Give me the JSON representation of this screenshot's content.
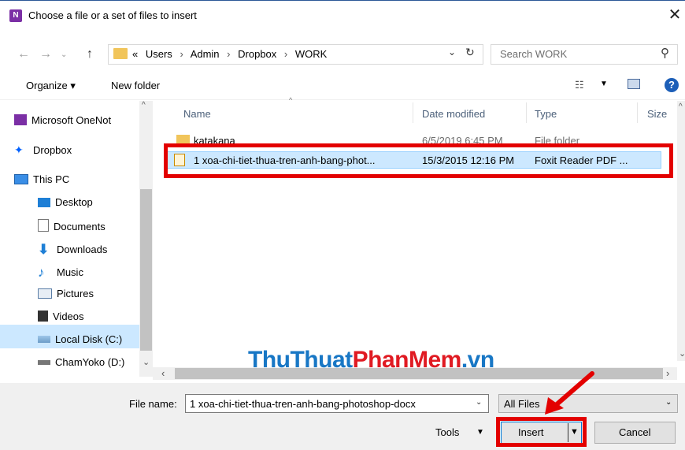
{
  "window": {
    "title": "Choose a file or a set of files to insert",
    "app_icon": "onenote-icon",
    "close": "✕"
  },
  "address": {
    "crumbs": [
      "«",
      "Users",
      "Admin",
      "Dropbox",
      "WORK"
    ],
    "separator": "›",
    "search_placeholder": "Search WORK"
  },
  "toolbar": {
    "organize": "Organize ▾",
    "new_folder": "New folder"
  },
  "nav": {
    "items": [
      {
        "label": "Microsoft OneNot",
        "icon": "onenote-icon"
      },
      {
        "label": "Dropbox",
        "icon": "dropbox-icon"
      },
      {
        "label": "This PC",
        "icon": "pc-icon"
      },
      {
        "label": "Desktop",
        "icon": "desktop-icon"
      },
      {
        "label": "Documents",
        "icon": "documents-icon"
      },
      {
        "label": "Downloads",
        "icon": "downloads-icon"
      },
      {
        "label": "Music",
        "icon": "music-icon"
      },
      {
        "label": "Pictures",
        "icon": "pictures-icon"
      },
      {
        "label": "Videos",
        "icon": "videos-icon"
      },
      {
        "label": "Local Disk (C:)",
        "icon": "disk-icon"
      },
      {
        "label": "ChamYoko (D:)",
        "icon": "drive-icon"
      }
    ],
    "selected": "Local Disk (C:)"
  },
  "list": {
    "columns": [
      "Name",
      "Date modified",
      "Type",
      "Size"
    ],
    "rows": [
      {
        "name": "katakana",
        "date": "6/5/2019 6:45 PM",
        "type": "File folder",
        "icon": "folder-icon"
      },
      {
        "name": "1 xoa-chi-tiet-thua-tren-anh-bang-phot...",
        "date": "15/3/2015 12:16 PM",
        "type": "Foxit Reader PDF ...",
        "icon": "pdf-icon"
      }
    ]
  },
  "watermark": {
    "part1": "ThuThuat",
    "part2": "PhanMem",
    "part3": ".vn"
  },
  "bottom": {
    "file_name_label": "File name:",
    "file_name_value": "1 xoa-chi-tiet-thua-tren-anh-bang-photoshop-docx",
    "file_type": "All Files",
    "tools": "Tools",
    "insert": "Insert",
    "cancel": "Cancel"
  },
  "colors": {
    "highlight_red": "#e30000",
    "selection": "#cce8ff",
    "watermark_blue": "#1877c5",
    "watermark_red": "#e01a22"
  }
}
